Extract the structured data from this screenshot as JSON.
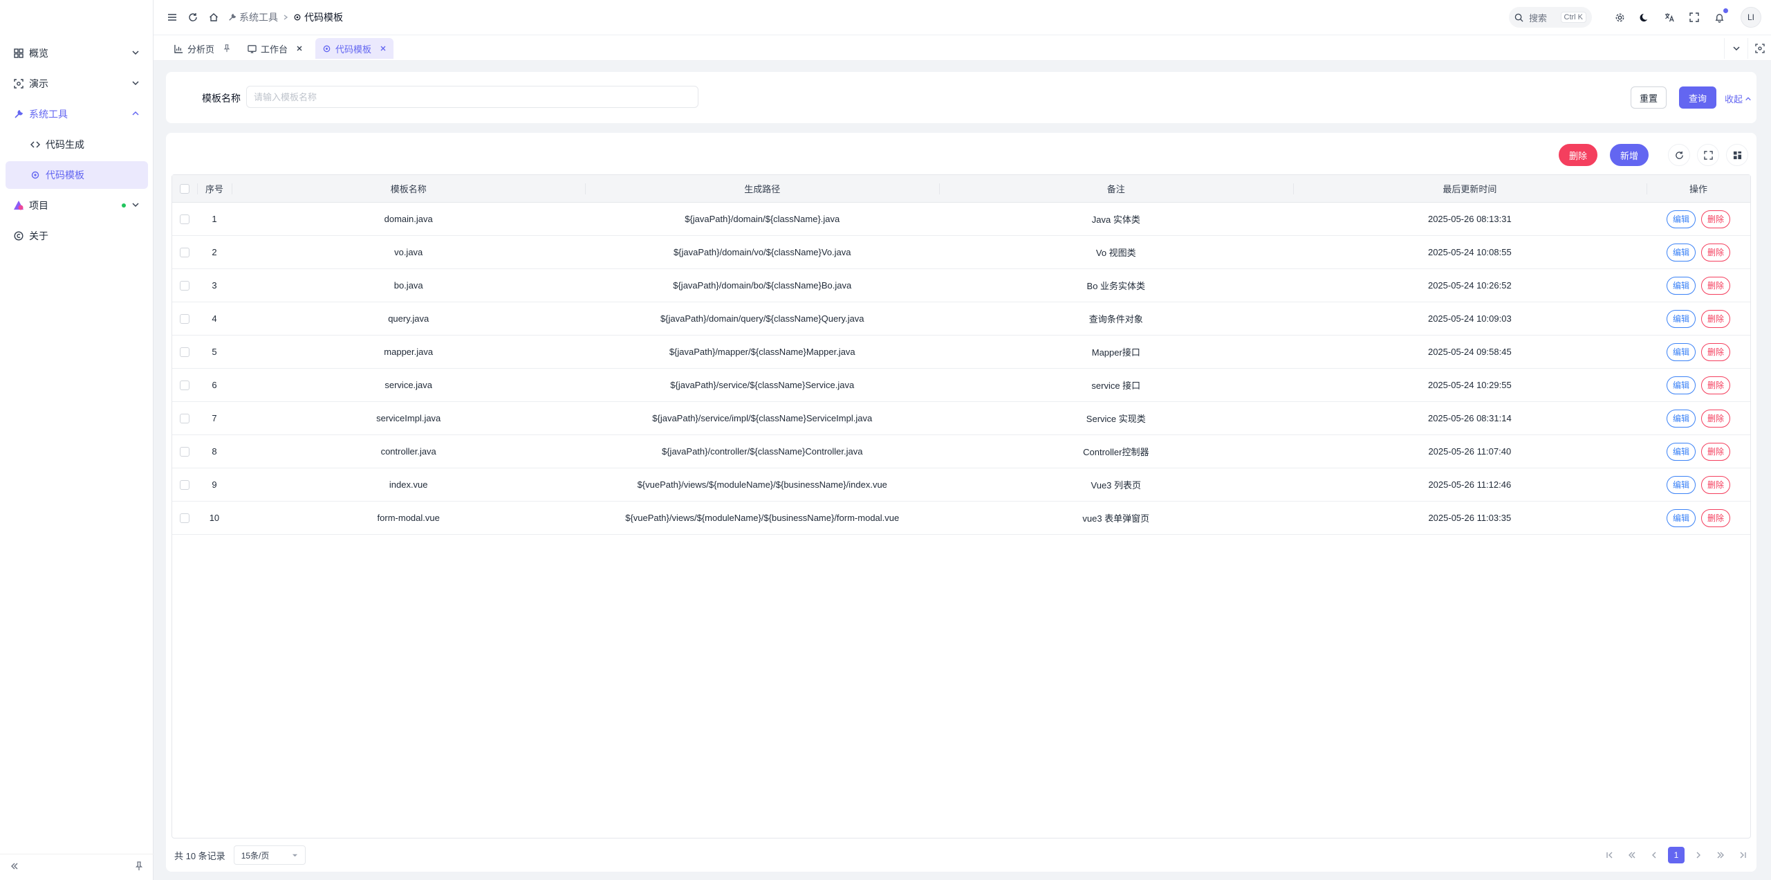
{
  "sidebar": {
    "items": [
      {
        "label": "概览",
        "icon": "dashboard-icon"
      },
      {
        "label": "演示",
        "icon": "demo-icon"
      },
      {
        "label": "系统工具",
        "icon": "wrench-icon"
      },
      {
        "label": "代码生成",
        "icon": "code-icon"
      },
      {
        "label": "代码模板",
        "icon": "template-icon"
      },
      {
        "label": "项目",
        "icon": "project-icon"
      },
      {
        "label": "关于",
        "icon": "copyright-icon"
      }
    ]
  },
  "header": {
    "breadcrumb": {
      "parent": "系统工具",
      "current": "代码模板"
    },
    "search": {
      "placeholder": "搜索",
      "shortcut": "Ctrl K"
    },
    "avatar": "LI"
  },
  "tabs": [
    {
      "label": "分析页",
      "icon": "chart-icon",
      "pinned": true
    },
    {
      "label": "工作台",
      "icon": "workbench-icon"
    },
    {
      "label": "代码模板",
      "icon": "template-icon",
      "active": true
    }
  ],
  "filter": {
    "label": "模板名称",
    "placeholder": "请输入模板名称",
    "value": "",
    "reset_label": "重置",
    "query_label": "查询",
    "collapse_label": "收起"
  },
  "toolbar": {
    "delete_label": "删除",
    "add_label": "新增"
  },
  "table": {
    "columns": {
      "no": "序号",
      "name": "模板名称",
      "path": "生成路径",
      "remark": "备注",
      "time": "最后更新时间",
      "ops": "操作"
    },
    "edit_label": "编辑",
    "delete_label": "删除",
    "rows": [
      {
        "no": "1",
        "name": "domain.java",
        "path": "${javaPath}/domain/${className}.java",
        "remark": "Java 实体类",
        "time": "2025-05-26 08:13:31"
      },
      {
        "no": "2",
        "name": "vo.java",
        "path": "${javaPath}/domain/vo/${className}Vo.java",
        "remark": "Vo 视图类",
        "time": "2025-05-24 10:08:55"
      },
      {
        "no": "3",
        "name": "bo.java",
        "path": "${javaPath}/domain/bo/${className}Bo.java",
        "remark": "Bo 业务实体类",
        "time": "2025-05-24 10:26:52"
      },
      {
        "no": "4",
        "name": "query.java",
        "path": "${javaPath}/domain/query/${className}Query.java",
        "remark": "查询条件对象",
        "time": "2025-05-24 10:09:03"
      },
      {
        "no": "5",
        "name": "mapper.java",
        "path": "${javaPath}/mapper/${className}Mapper.java",
        "remark": "Mapper接口",
        "time": "2025-05-24 09:58:45"
      },
      {
        "no": "6",
        "name": "service.java",
        "path": "${javaPath}/service/${className}Service.java",
        "remark": "service 接口",
        "time": "2025-05-24 10:29:55"
      },
      {
        "no": "7",
        "name": "serviceImpl.java",
        "path": "${javaPath}/service/impl/${className}ServiceImpl.java",
        "remark": "Service 实现类",
        "time": "2025-05-26 08:31:14"
      },
      {
        "no": "8",
        "name": "controller.java",
        "path": "${javaPath}/controller/${className}Controller.java",
        "remark": "Controller控制器",
        "time": "2025-05-26 11:07:40"
      },
      {
        "no": "9",
        "name": "index.vue",
        "path": "${vuePath}/views/${moduleName}/${businessName}/index.vue",
        "remark": "Vue3 列表页",
        "time": "2025-05-26 11:12:46"
      },
      {
        "no": "10",
        "name": "form-modal.vue",
        "path": "${vuePath}/views/${moduleName}/${businessName}/form-modal.vue",
        "remark": "vue3 表单弹窗页",
        "time": "2025-05-26 11:03:35"
      }
    ]
  },
  "pager": {
    "total": "共 10 条记录",
    "page_size": "15条/页",
    "current_page": "1"
  },
  "colors": {
    "accent": "#6366f1",
    "danger": "#f43f5e",
    "edit": "#3b82f6"
  }
}
